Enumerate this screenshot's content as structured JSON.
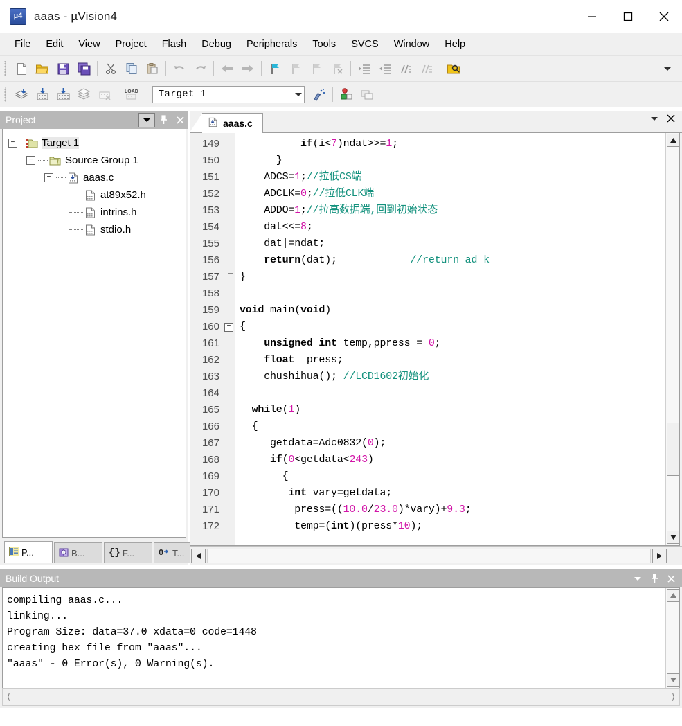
{
  "window": {
    "title": "aaas  -  µVision4",
    "app_icon": "uvision-logo-icon",
    "controls": {
      "minimize": "minimize-icon",
      "maximize": "maximize-icon",
      "close": "close-icon"
    }
  },
  "menubar": {
    "items": [
      {
        "label": "File",
        "mnemonic": "F"
      },
      {
        "label": "Edit",
        "mnemonic": "E"
      },
      {
        "label": "View",
        "mnemonic": "V"
      },
      {
        "label": "Project",
        "mnemonic": "P"
      },
      {
        "label": "Flash",
        "mnemonic": "a"
      },
      {
        "label": "Debug",
        "mnemonic": "D"
      },
      {
        "label": "Peripherals",
        "mnemonic": "i"
      },
      {
        "label": "Tools",
        "mnemonic": "T"
      },
      {
        "label": "SVCS",
        "mnemonic": "S"
      },
      {
        "label": "Window",
        "mnemonic": "W"
      },
      {
        "label": "Help",
        "mnemonic": "H"
      }
    ]
  },
  "toolbar_main": {
    "buttons": [
      "new-file-icon",
      "open-file-icon",
      "save-icon",
      "save-all-icon",
      "cut-icon",
      "copy-icon",
      "paste-icon",
      "undo-icon",
      "redo-icon",
      "navigate-back-icon",
      "navigate-forward-icon",
      "bookmark-toggle-icon",
      "bookmark-prev-icon",
      "bookmark-next-icon",
      "bookmark-clear-icon",
      "indent-icon",
      "outdent-icon",
      "comment-icon",
      "uncomment-icon",
      "find-in-files-icon"
    ],
    "find_field_value": "",
    "overflow": "toolbar-overflow-icon"
  },
  "toolbar_build": {
    "buttons": [
      "translate-icon",
      "build-target-icon",
      "rebuild-all-icon",
      "batch-build-icon",
      "stop-build-icon",
      "download-icon"
    ],
    "target_selector": {
      "value": "Target 1",
      "dropdown": "chevron-down-icon"
    },
    "right_buttons": [
      "target-options-icon",
      "manage-components-icon",
      "multi-project-icon"
    ]
  },
  "project_panel": {
    "title": "Project",
    "header_buttons": [
      "panel-menu-icon",
      "pin-icon",
      "close-icon"
    ],
    "tree": [
      {
        "label": "Target 1",
        "level": 0,
        "expander": "-",
        "icon": "target-folder-icon",
        "selected": true
      },
      {
        "label": "Source Group 1",
        "level": 1,
        "expander": "-",
        "icon": "group-folder-icon",
        "selected": false
      },
      {
        "label": "aaas.c",
        "level": 2,
        "expander": "-",
        "icon": "c-source-icon",
        "selected": false
      },
      {
        "label": "at89x52.h",
        "level": 3,
        "expander": "",
        "icon": "header-file-icon",
        "selected": false
      },
      {
        "label": "intrins.h",
        "level": 3,
        "expander": "",
        "icon": "header-file-icon",
        "selected": false
      },
      {
        "label": "stdio.h",
        "level": 3,
        "expander": "",
        "icon": "header-file-icon",
        "selected": false
      }
    ],
    "tabs": [
      {
        "label": "P...",
        "icon": "project-icon",
        "active": true
      },
      {
        "label": "B...",
        "icon": "books-icon",
        "active": false
      },
      {
        "label": "F...",
        "icon": "functions-icon",
        "active": false
      },
      {
        "label": "T...",
        "icon": "templates-icon",
        "active": false
      }
    ]
  },
  "editor": {
    "tab": {
      "label": "aaas.c",
      "icon": "c-source-icon"
    },
    "header_buttons": [
      "panel-menu-icon",
      "close-icon"
    ],
    "first_line": 149,
    "lines": [
      {
        "n": 149,
        "fold": "",
        "tokens": [
          {
            "t": "          if",
            "c": "kw"
          },
          {
            "t": "(i<",
            "c": "pnc"
          },
          {
            "t": "7",
            "c": "num"
          },
          {
            "t": ")ndat>>=",
            "c": "pnc"
          },
          {
            "t": "1",
            "c": "num"
          },
          {
            "t": ";",
            "c": "pnc"
          }
        ]
      },
      {
        "n": 150,
        "fold": "",
        "tokens": [
          {
            "t": "      }",
            "c": "pnc"
          }
        ]
      },
      {
        "n": 151,
        "fold": "",
        "tokens": [
          {
            "t": "    ADCS=",
            "c": "pnc"
          },
          {
            "t": "1",
            "c": "num"
          },
          {
            "t": ";",
            "c": "pnc"
          },
          {
            "t": "//拉低CS端",
            "c": "cmt"
          }
        ]
      },
      {
        "n": 152,
        "fold": "",
        "tokens": [
          {
            "t": "    ADCLK=",
            "c": "pnc"
          },
          {
            "t": "0",
            "c": "num"
          },
          {
            "t": ";",
            "c": "pnc"
          },
          {
            "t": "//拉低CLK端",
            "c": "cmt"
          }
        ]
      },
      {
        "n": 153,
        "fold": "",
        "tokens": [
          {
            "t": "    ADDO=",
            "c": "pnc"
          },
          {
            "t": "1",
            "c": "num"
          },
          {
            "t": ";",
            "c": "pnc"
          },
          {
            "t": "//拉高数据端,回到初始状态",
            "c": "cmt"
          }
        ]
      },
      {
        "n": 154,
        "fold": "",
        "tokens": [
          {
            "t": "    dat<<=",
            "c": "pnc"
          },
          {
            "t": "8",
            "c": "num"
          },
          {
            "t": ";",
            "c": "pnc"
          }
        ]
      },
      {
        "n": 155,
        "fold": "",
        "tokens": [
          {
            "t": "    dat|=ndat;",
            "c": "pnc"
          }
        ]
      },
      {
        "n": 156,
        "fold": "",
        "tokens": [
          {
            "t": "    return",
            "c": "kw"
          },
          {
            "t": "(dat);            ",
            "c": "pnc"
          },
          {
            "t": "//return ad k",
            "c": "cmt"
          }
        ]
      },
      {
        "n": 157,
        "fold": "end",
        "tokens": [
          {
            "t": "}",
            "c": "pnc"
          }
        ]
      },
      {
        "n": 158,
        "fold": "",
        "tokens": [
          {
            "t": "",
            "c": "pnc"
          }
        ]
      },
      {
        "n": 159,
        "fold": "",
        "tokens": [
          {
            "t": "void",
            "c": "kw"
          },
          {
            "t": " main(",
            "c": "pnc"
          },
          {
            "t": "void",
            "c": "kw"
          },
          {
            "t": ")",
            "c": "pnc"
          }
        ]
      },
      {
        "n": 160,
        "fold": "start",
        "tokens": [
          {
            "t": "{",
            "c": "pnc"
          }
        ]
      },
      {
        "n": 161,
        "fold": "",
        "tokens": [
          {
            "t": "    unsigned int",
            "c": "kw"
          },
          {
            "t": " temp,ppress = ",
            "c": "pnc"
          },
          {
            "t": "0",
            "c": "num"
          },
          {
            "t": ";",
            "c": "pnc"
          }
        ]
      },
      {
        "n": 162,
        "fold": "",
        "tokens": [
          {
            "t": "    float",
            "c": "kw"
          },
          {
            "t": "  press;",
            "c": "pnc"
          }
        ]
      },
      {
        "n": 163,
        "fold": "",
        "tokens": [
          {
            "t": "    chushihua(); ",
            "c": "pnc"
          },
          {
            "t": "//LCD1602初始化",
            "c": "cmt"
          }
        ]
      },
      {
        "n": 164,
        "fold": "",
        "tokens": [
          {
            "t": "",
            "c": "pnc"
          }
        ]
      },
      {
        "n": 165,
        "fold": "",
        "tokens": [
          {
            "t": "  while",
            "c": "kw"
          },
          {
            "t": "(",
            "c": "pnc"
          },
          {
            "t": "1",
            "c": "num"
          },
          {
            "t": ")",
            "c": "pnc"
          }
        ]
      },
      {
        "n": 166,
        "fold": "",
        "tokens": [
          {
            "t": "  {",
            "c": "pnc"
          }
        ]
      },
      {
        "n": 167,
        "fold": "",
        "tokens": [
          {
            "t": "     getdata=Adc0832(",
            "c": "pnc"
          },
          {
            "t": "0",
            "c": "num"
          },
          {
            "t": ");",
            "c": "pnc"
          }
        ]
      },
      {
        "n": 168,
        "fold": "",
        "tokens": [
          {
            "t": "     if",
            "c": "kw"
          },
          {
            "t": "(",
            "c": "pnc"
          },
          {
            "t": "0",
            "c": "num"
          },
          {
            "t": "<getdata<",
            "c": "pnc"
          },
          {
            "t": "243",
            "c": "num"
          },
          {
            "t": ")",
            "c": "pnc"
          }
        ]
      },
      {
        "n": 169,
        "fold": "",
        "tokens": [
          {
            "t": "       {",
            "c": "pnc"
          }
        ]
      },
      {
        "n": 170,
        "fold": "",
        "tokens": [
          {
            "t": "        int",
            "c": "kw"
          },
          {
            "t": " vary=getdata;",
            "c": "pnc"
          }
        ]
      },
      {
        "n": 171,
        "fold": "",
        "tokens": [
          {
            "t": "         press=((",
            "c": "pnc"
          },
          {
            "t": "10.0",
            "c": "num"
          },
          {
            "t": "/",
            "c": "pnc"
          },
          {
            "t": "23.0",
            "c": "num"
          },
          {
            "t": ")*vary)+",
            "c": "pnc"
          },
          {
            "t": "9.3",
            "c": "num"
          },
          {
            "t": ";",
            "c": "pnc"
          }
        ]
      },
      {
        "n": 172,
        "fold": "",
        "tokens": [
          {
            "t": "         temp=(",
            "c": "pnc"
          },
          {
            "t": "int",
            "c": "kw"
          },
          {
            "t": ")(press*",
            "c": "pnc"
          },
          {
            "t": "10",
            "c": "num"
          },
          {
            "t": ");",
            "c": "pnc"
          }
        ]
      }
    ],
    "scroll": {
      "up_arrow": "scroll-up-icon",
      "down_arrow": "scroll-down-icon",
      "left_arrow": "scroll-left-icon",
      "right_arrow": "scroll-right-icon"
    }
  },
  "build_output": {
    "title": "Build Output",
    "header_buttons": [
      "panel-menu-icon",
      "pin-icon",
      "close-icon"
    ],
    "lines": [
      "compiling aaas.c...",
      "linking...",
      "Program Size: data=37.0 xdata=0 code=1448",
      "creating hex file from \"aaas\"...",
      "\"aaas\" - 0 Error(s), 0 Warning(s)."
    ],
    "scroll": {
      "up_arrow": "scroll-up-icon",
      "down_arrow": "scroll-down-icon",
      "left_chevron": "chevron-left-icon",
      "right_chevron": "chevron-right-icon"
    }
  },
  "colors": {
    "panel_header": "#b8b8b8",
    "chrome": "#f0f0f0",
    "comment": "#13917d",
    "number": "#d215a8",
    "keyword": "#000000"
  }
}
